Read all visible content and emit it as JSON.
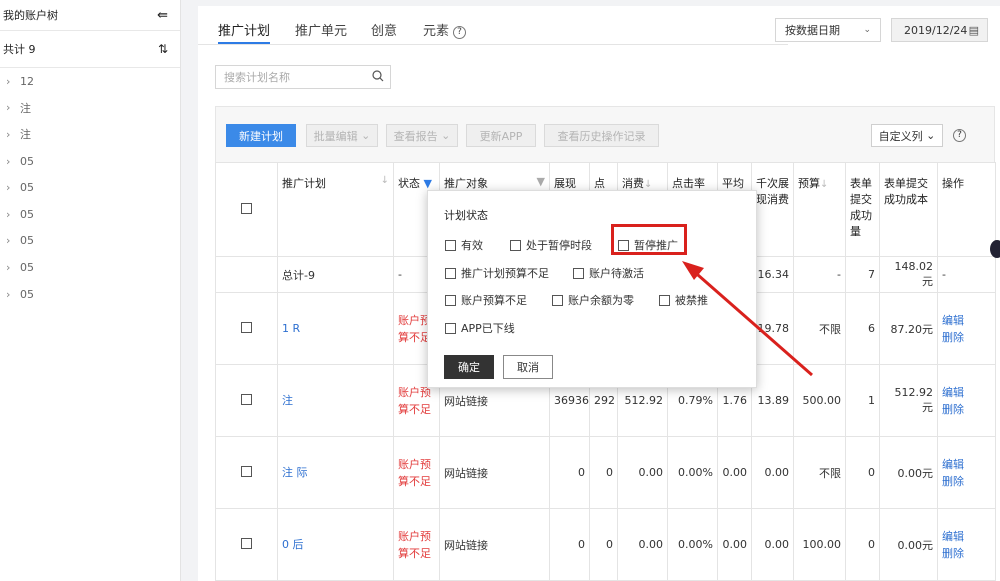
{
  "sidebar": {
    "title": "我的账户树",
    "count_label": "共计 9",
    "items": [
      "12",
      "注",
      "注",
      "05",
      "05",
      "05",
      "05",
      "05",
      "05"
    ]
  },
  "tabs": [
    {
      "label": "推广计划",
      "active": true
    },
    {
      "label": "推广单元",
      "active": false
    },
    {
      "label": "创意",
      "active": false
    },
    {
      "label": "元素",
      "active": false
    }
  ],
  "date_type_select": "按数据日期",
  "date_value": "2019/12/24",
  "search_placeholder": "搜索计划名称",
  "toolbar": {
    "new_plan": "新建计划",
    "batch_edit": "批量编辑",
    "view_report": "查看报告",
    "update_app": "更新APP",
    "view_history": "查看历史操作记录",
    "custom_columns": "自定义列"
  },
  "columns": [
    "推广计划",
    "状态",
    "推广对象",
    "展现",
    "点",
    "消费",
    "点击率",
    "平均",
    "千次展现消费",
    "预算",
    "表单提交成功量",
    "表单提交成功成本",
    "操作"
  ],
  "total_row": {
    "name": "总计-9",
    "status": "-",
    "cpm": "16.34",
    "budget": "-",
    "forms": "7",
    "form_cost": "148.02元",
    "ops": "-"
  },
  "rows": [
    {
      "name": "1 R",
      "status": "账户预算不足",
      "target": "",
      "impressions": "",
      "clicks": "",
      "cost": "",
      "ctr": "",
      "avg": "",
      "cpm": "19.78",
      "budget": "不限",
      "forms": "6",
      "form_cost": "87.20元",
      "edit": "编辑",
      "delete": "删除"
    },
    {
      "name": "注",
      "status": "账户预算不足",
      "target": "网站链接",
      "impressions": "36936",
      "clicks": "292",
      "cost": "512.92",
      "ctr": "0.79%",
      "avg": "1.76",
      "cpm": "13.89",
      "budget": "500.00",
      "forms": "1",
      "form_cost": "512.92元",
      "edit": "编辑",
      "delete": "删除"
    },
    {
      "name": "注 际",
      "status": "账户预算不足",
      "target": "网站链接",
      "impressions": "0",
      "clicks": "0",
      "cost": "0.00",
      "ctr": "0.00%",
      "avg": "0.00",
      "cpm": "0.00",
      "budget": "不限",
      "forms": "0",
      "form_cost": "0.00元",
      "edit": "编辑",
      "delete": "删除"
    },
    {
      "name": "0 后",
      "status": "账户预算不足",
      "target": "网站链接",
      "impressions": "0",
      "clicks": "0",
      "cost": "0.00",
      "ctr": "0.00%",
      "avg": "0.00",
      "cpm": "0.00",
      "budget": "100.00",
      "forms": "0",
      "form_cost": "0.00元",
      "edit": "编辑",
      "delete": "删除"
    }
  ],
  "filter_popup": {
    "title": "计划状态",
    "options": [
      "有效",
      "处于暂停时段",
      "暂停推广",
      "推广计划预算不足",
      "账户待激活",
      "账户预算不足",
      "账户余额为零",
      "被禁推",
      "APP已下线"
    ],
    "ok": "确定",
    "cancel": "取消"
  },
  "colors": {
    "accent": "#3b8ae8",
    "highlight": "#d9211d",
    "warning_text": "#e23b3b"
  }
}
